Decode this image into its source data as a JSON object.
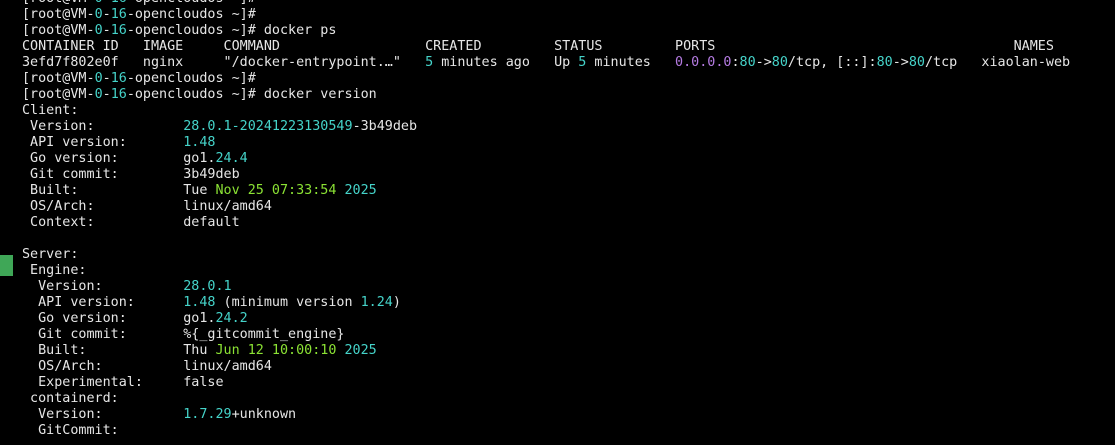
{
  "colors": {
    "background": "#000000",
    "foreground": "#e6e6e6",
    "cyan": "#45d3c9",
    "green": "#8be234",
    "purple": "#b57be2",
    "marker": "#3fa757"
  },
  "terminal": {
    "lines": [
      [
        {
          "t": "[root@VM-"
        },
        {
          "t": "0",
          "c": "cyan"
        },
        {
          "t": "-"
        },
        {
          "t": "16",
          "c": "cyan"
        },
        {
          "t": "-opencloudos ~]#"
        }
      ],
      [
        {
          "t": "[root@VM-"
        },
        {
          "t": "0",
          "c": "cyan"
        },
        {
          "t": "-"
        },
        {
          "t": "16",
          "c": "cyan"
        },
        {
          "t": "-opencloudos ~]#"
        }
      ],
      [
        {
          "t": "[root@VM-"
        },
        {
          "t": "0",
          "c": "cyan"
        },
        {
          "t": "-"
        },
        {
          "t": "16",
          "c": "cyan"
        },
        {
          "t": "-opencloudos ~]# docker ps"
        }
      ],
      [
        {
          "t": "CONTAINER ID   IMAGE     COMMAND                  CREATED         STATUS         PORTS                                     NAMES"
        }
      ],
      [
        {
          "t": "3efd7f802e0f   nginx     \"/docker-entrypoint.…\"   "
        },
        {
          "t": "5",
          "c": "cyan"
        },
        {
          "t": " minutes ago   Up "
        },
        {
          "t": "5",
          "c": "cyan"
        },
        {
          "t": " minutes   "
        },
        {
          "t": "0.0.0.0",
          "c": "purple"
        },
        {
          "t": ":"
        },
        {
          "t": "80",
          "c": "cyan"
        },
        {
          "t": "->"
        },
        {
          "t": "80",
          "c": "cyan"
        },
        {
          "t": "/tcp, [::]:"
        },
        {
          "t": "80",
          "c": "cyan"
        },
        {
          "t": "->"
        },
        {
          "t": "80",
          "c": "cyan"
        },
        {
          "t": "/tcp   xiaolan-web"
        }
      ],
      [
        {
          "t": "[root@VM-"
        },
        {
          "t": "0",
          "c": "cyan"
        },
        {
          "t": "-"
        },
        {
          "t": "16",
          "c": "cyan"
        },
        {
          "t": "-opencloudos ~]#"
        }
      ],
      [
        {
          "t": "[root@VM-"
        },
        {
          "t": "0",
          "c": "cyan"
        },
        {
          "t": "-"
        },
        {
          "t": "16",
          "c": "cyan"
        },
        {
          "t": "-opencloudos ~]# docker version"
        }
      ],
      [
        {
          "t": "Client:"
        }
      ],
      [
        {
          "t": " Version:           "
        },
        {
          "t": "28.0.1-20241223130549",
          "c": "cyan"
        },
        {
          "t": "-3b49deb"
        }
      ],
      [
        {
          "t": " API version:       "
        },
        {
          "t": "1.48",
          "c": "cyan"
        }
      ],
      [
        {
          "t": " Go version:        go1."
        },
        {
          "t": "24.4",
          "c": "cyan"
        }
      ],
      [
        {
          "t": " Git commit:        3b49deb"
        }
      ],
      [
        {
          "t": " Built:             Tue "
        },
        {
          "t": "Nov 25 07:33:54",
          "c": "green"
        },
        {
          "t": " "
        },
        {
          "t": "2025",
          "c": "cyan"
        }
      ],
      [
        {
          "t": " OS/Arch:           linux/amd64"
        }
      ],
      [
        {
          "t": " Context:           default"
        }
      ],
      [
        {
          "t": ""
        }
      ],
      [
        {
          "t": "Server:"
        }
      ],
      [
        {
          "t": " Engine:"
        }
      ],
      [
        {
          "t": "  Version:          "
        },
        {
          "t": "28.0.1",
          "c": "cyan"
        }
      ],
      [
        {
          "t": "  API version:      "
        },
        {
          "t": "1.48",
          "c": "cyan"
        },
        {
          "t": " (minimum version "
        },
        {
          "t": "1.24",
          "c": "cyan"
        },
        {
          "t": ")"
        }
      ],
      [
        {
          "t": "  Go version:       go1."
        },
        {
          "t": "24.2",
          "c": "cyan"
        }
      ],
      [
        {
          "t": "  Git commit:       %{_gitcommit_engine}"
        }
      ],
      [
        {
          "t": "  Built:            Thu "
        },
        {
          "t": "Jun 12 10:00:10",
          "c": "green"
        },
        {
          "t": " "
        },
        {
          "t": "2025",
          "c": "cyan"
        }
      ],
      [
        {
          "t": "  OS/Arch:          linux/amd64"
        }
      ],
      [
        {
          "t": "  Experimental:     false"
        }
      ],
      [
        {
          "t": " containerd:"
        }
      ],
      [
        {
          "t": "  Version:          "
        },
        {
          "t": "1.7.29",
          "c": "cyan"
        },
        {
          "t": "+unknown"
        }
      ],
      [
        {
          "t": "  GitCommit:"
        }
      ]
    ]
  }
}
